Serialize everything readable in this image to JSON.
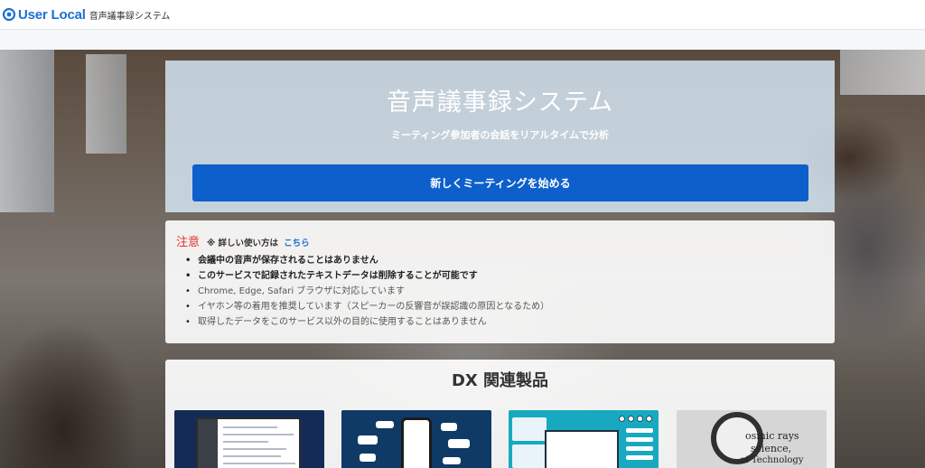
{
  "header": {
    "brand": "User Local",
    "system_name": "音声議事録システム",
    "logo_icon": "user-local-logo-icon"
  },
  "hero": {
    "title": "音声議事録システム",
    "subtitle": "ミーティング参加者の会話をリアルタイムで分析",
    "start_button": "新しくミーティングを始める",
    "colors": {
      "button": "#0d5fcc",
      "panel": "#d6e8f5"
    }
  },
  "notice": {
    "title": "注意",
    "note": "※ 詳しい使い方は",
    "link_text": "こちら",
    "items": [
      {
        "text": "会議中の音声が保存されることはありません",
        "emphasis": true
      },
      {
        "text": "このサービスで記録されたテキストデータは削除することが可能です",
        "emphasis": true
      },
      {
        "text": "Chrome, Edge, Safari ブラウザに対応しています",
        "emphasis": false
      },
      {
        "text": "イヤホン等の着用を推奨しています（スピーカーの反響音が誤認識の原因となるため）",
        "emphasis": false
      },
      {
        "text": "取得したデータをこのサービス以外の目的に使用することはありません",
        "emphasis": false
      }
    ],
    "colors": {
      "title": "#e0352b",
      "link": "#1c6fd1"
    }
  },
  "products": {
    "title": "DX 関連製品",
    "cards": [
      {
        "icon": "laptop-app-screenshot-icon"
      },
      {
        "icon": "smartphone-chat-icon"
      },
      {
        "icon": "chatbot-screen-icon"
      },
      {
        "icon": "magnifier-text-icon",
        "visible_text": [
          "osmic rays",
          "science,",
          "of Technology"
        ]
      }
    ]
  }
}
